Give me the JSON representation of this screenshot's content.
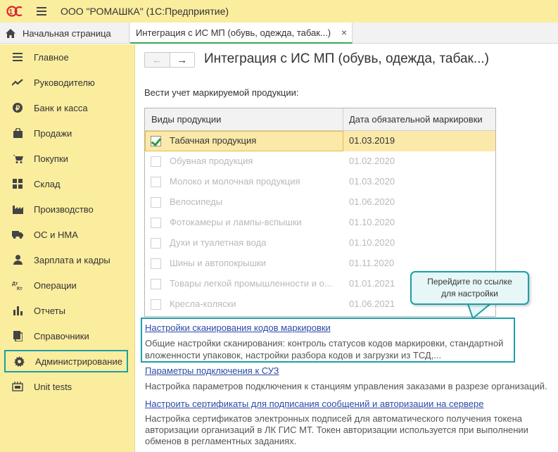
{
  "app": {
    "title": "ООО \"РОМАШКА\"  (1С:Предприятие)",
    "logo_text": "1С"
  },
  "tabs": {
    "home_label": "Начальная страница",
    "active_label": "Интеграция с ИС МП (обувь, одежда, табак...)",
    "close_glyph": "×"
  },
  "sidebar": {
    "items": [
      {
        "label": "Главное",
        "icon": "menu-lines-icon"
      },
      {
        "label": "Руководителю",
        "icon": "trend-icon"
      },
      {
        "label": "Банк и касса",
        "icon": "coin-icon"
      },
      {
        "label": "Продажи",
        "icon": "bag-icon"
      },
      {
        "label": "Покупки",
        "icon": "cart-icon"
      },
      {
        "label": "Склад",
        "icon": "warehouse-icon"
      },
      {
        "label": "Производство",
        "icon": "factory-icon"
      },
      {
        "label": "ОС и НМА",
        "icon": "truck-icon"
      },
      {
        "label": "Зарплата и кадры",
        "icon": "person-icon"
      },
      {
        "label": "Операции",
        "icon": "dt-kt-icon"
      },
      {
        "label": "Отчеты",
        "icon": "bar-chart-icon"
      },
      {
        "label": "Справочники",
        "icon": "book-icon"
      },
      {
        "label": "Администрирование",
        "icon": "gear-icon",
        "active": true
      },
      {
        "label": "Unit tests",
        "icon": "tests-icon"
      }
    ]
  },
  "main": {
    "title": "Интеграция с ИС МП (обувь, одежда, табак...)",
    "intro": "Вести учет маркируемой продукции:",
    "grid": {
      "headers": [
        "Виды продукции",
        "Дата обязательной маркировки"
      ],
      "rows": [
        {
          "name": "Табачная продукция",
          "date": "01.03.2019",
          "checked": true,
          "enabled": true
        },
        {
          "name": "Обувная продукция",
          "date": "01.02.2020",
          "checked": false,
          "enabled": false
        },
        {
          "name": "Молоко и молочная продукция",
          "date": "01.03.2020",
          "checked": false,
          "enabled": false
        },
        {
          "name": "Велосипеды",
          "date": "01.06.2020",
          "checked": false,
          "enabled": false
        },
        {
          "name": "Фотокамеры и лампы-вспышки",
          "date": "01.10.2020",
          "checked": false,
          "enabled": false
        },
        {
          "name": "Духи и туалетная вода",
          "date": "01.10.2020",
          "checked": false,
          "enabled": false
        },
        {
          "name": "Шины и автопокрышки",
          "date": "01.11.2020",
          "checked": false,
          "enabled": false
        },
        {
          "name": "Товары легкой промышленности и о...",
          "date": "01.01.2021",
          "checked": false,
          "enabled": false
        },
        {
          "name": "Кресла-коляски",
          "date": "01.06.2021",
          "checked": false,
          "enabled": false
        }
      ]
    },
    "callout": {
      "line1": "Перейдите по ссылке",
      "line2": "для настройки"
    },
    "links": [
      {
        "label": "Настройки сканирования кодов маркировки",
        "desc1": "Общие настройки сканирования: контроль статусов кодов маркировки, стандартной",
        "desc2": "вложенности упаковок, настройки разбора кодов и загрузки из ТСД,..."
      },
      {
        "label": "Параметры подключения к СУЗ",
        "desc1": "Настройка параметров подключения к станциям управления заказами в разрезе организаций."
      },
      {
        "label": "Настроить сертификаты для подписания сообщений и авторизации на сервере",
        "desc1": "Настройка сертификатов электронных подписей для автоматического получения токена",
        "desc2": "авторизации организаций в ЛК ГИС МТ. Токен авторизации используется при выполнении",
        "desc3": "обменов в регламентных заданиях."
      }
    ]
  },
  "colors": {
    "sidebar_bg": "#fbed9e",
    "accent_teal": "#1ba0a6",
    "link": "#2c4aa8",
    "selected_row": "#fbe9a9",
    "check_green": "#2e9c3e"
  }
}
